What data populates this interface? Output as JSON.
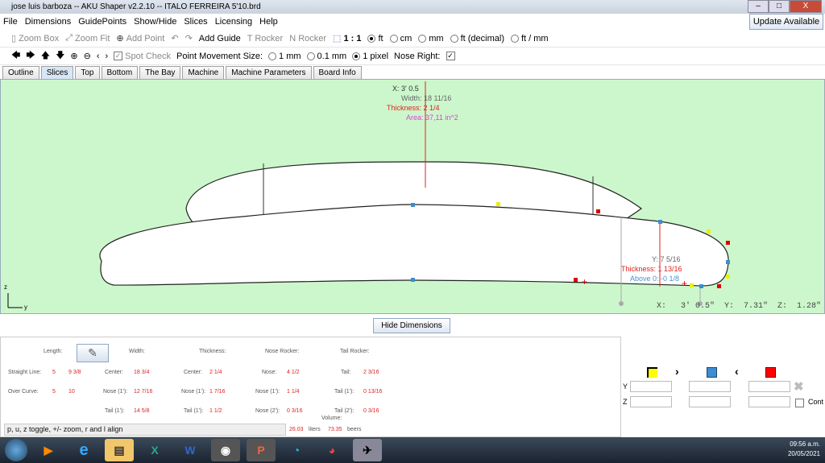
{
  "window": {
    "title": "jose luis barboza -- AKU Shaper v2.2.10  --  ITALO FERREIRA 5'10.brd",
    "controls": [
      "–",
      "□",
      "X"
    ]
  },
  "menu": [
    "File",
    "Dimensions",
    "GuidePoints",
    "Show/Hide",
    "Slices",
    "Licensing",
    "Help"
  ],
  "update_button": "Update Available",
  "toolbar1": {
    "zoom_box": "Zoom Box",
    "zoom_fit": "Zoom Fit",
    "add_point": "Add Point",
    "add_guide": "Add Guide",
    "t_rocker": "T Rocker",
    "n_rocker": "N Rocker",
    "scale": "1 : 1",
    "units": [
      {
        "label": "ft",
        "selected": true
      },
      {
        "label": "cm",
        "selected": false
      },
      {
        "label": "mm",
        "selected": false
      },
      {
        "label": "ft (decimal)",
        "selected": false
      },
      {
        "label": "ft / mm",
        "selected": false
      }
    ]
  },
  "toolbar2": {
    "spot_check": "Spot Check",
    "spot_check_checked": true,
    "movement_label": "Point Movement Size:",
    "movement": [
      {
        "label": "1 mm",
        "selected": false
      },
      {
        "label": "0.1 mm",
        "selected": false
      },
      {
        "label": "1 pixel",
        "selected": true
      }
    ],
    "nose_right": "Nose Right:",
    "nose_right_checked": true
  },
  "tabs": [
    {
      "label": "Outline"
    },
    {
      "label": "Slices",
      "selected": true
    },
    {
      "label": "Top"
    },
    {
      "label": "Bottom"
    },
    {
      "label": "The Bay"
    },
    {
      "label": "Machine"
    },
    {
      "label": "Machine Parameters"
    },
    {
      "label": "Board Info"
    }
  ],
  "canvas": {
    "outline_readout": {
      "x": "X: 3' 0.5",
      "width": "Width: 18 11/16",
      "thickness": "Thickness: 2 1/4",
      "area": "Area: 37,11 in^2"
    },
    "profile_readout": {
      "y": "Y: 7 5/16",
      "thickness": "Thickness: 1 13/16",
      "above": "Above 0: -0 1/8"
    },
    "axis_z": "z",
    "axis_y": "y",
    "coords": "X:   3' 0.5\"  Y:  7.31\"  Z:  1.28\"",
    "colors": {
      "background": "#ccf7cc",
      "thickness": "#e02020",
      "above": "#4a90d0",
      "area": "#e040e0"
    }
  },
  "hide_dimensions": "Hide Dimensions",
  "dims": {
    "headers": {
      "length": "Length:",
      "width": "Width:",
      "thickness": "Thickness:",
      "nose_rocker": "Nose Rocker:",
      "tail_rocker": "Tail Rocker:"
    },
    "straight_line": {
      "label": "Straight Line:",
      "ft": "5",
      "in": "9 3/8"
    },
    "over_curve": {
      "label": "Over Curve:",
      "ft": "5",
      "in": "10"
    },
    "width": {
      "center": "18 3/4",
      "nose1": "12 7/16",
      "tail1": "14 5/8"
    },
    "thickness": {
      "center": "2 1/4",
      "nose1": "1 7/16",
      "tail1": "1 1/2"
    },
    "nose_rocker": {
      "nose": "4 1/2",
      "nose1": "1 1/4",
      "nose2": "0 3/16"
    },
    "tail_rocker": {
      "tail": "2 3/16",
      "tail1": "0 13/16",
      "tail2": "0 3/16"
    },
    "labels": {
      "center": "Center:",
      "nose": "Nose:",
      "tail": "Tail:",
      "nose1": "Nose (1'):",
      "tail1": "Tail (1'):",
      "nose2": "Nose (2'):",
      "tail2": "Tail (2'):",
      "volume": "Volume:",
      "liters": "liters",
      "beers": "beers"
    },
    "volume": {
      "liters": "26.03",
      "beers": "73.35"
    },
    "hint": "p, u, z toggle, +/- zoom, r and l align"
  },
  "control_panel": {
    "y": "Y",
    "z": "Z",
    "cont": "Cont"
  },
  "taskbar": {
    "time": "09:56 a.m.",
    "date": "20/05/2021"
  }
}
